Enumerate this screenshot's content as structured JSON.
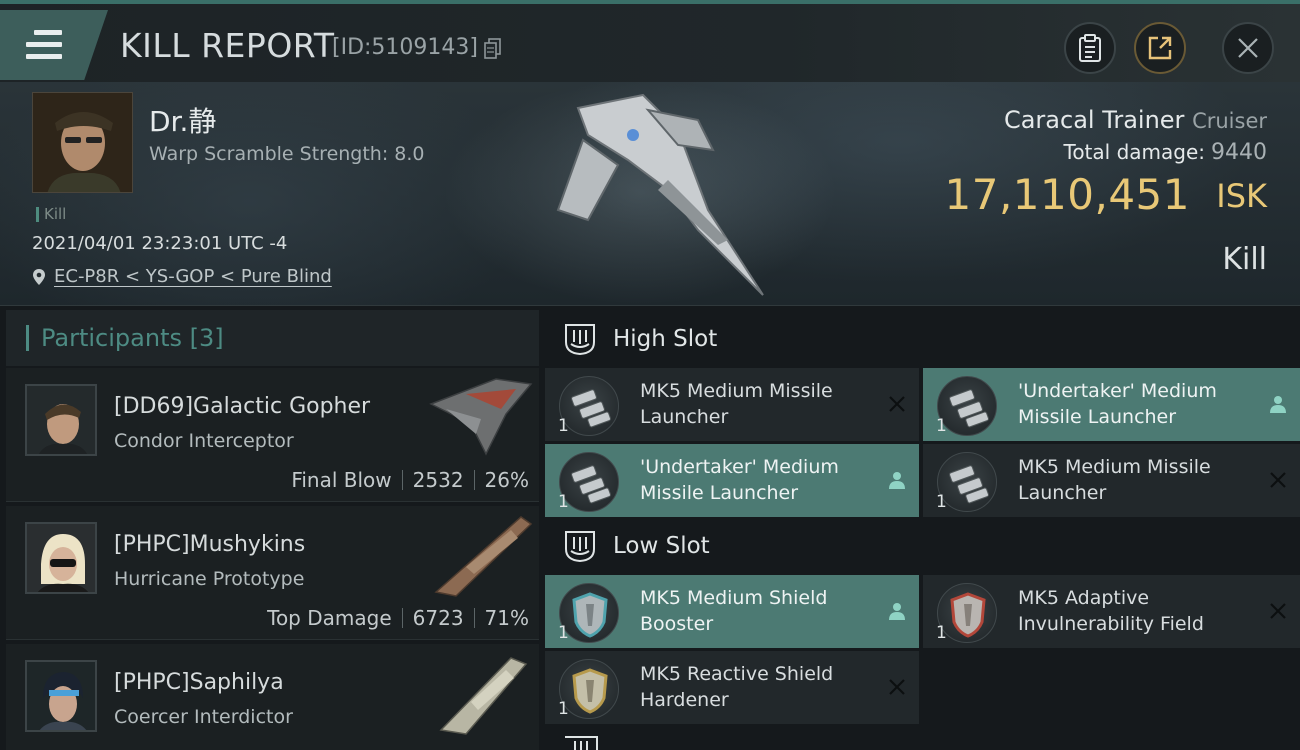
{
  "header": {
    "title": "KILL REPORT",
    "report_id": "[ID:5109143]",
    "icons": {
      "menu": "hamburger-menu-icon",
      "copy": "copy-icon",
      "clipboard": "clipboard-icon",
      "export": "export-icon",
      "close": "close-icon"
    }
  },
  "victim": {
    "name": "Dr.静",
    "warp_scramble": "Warp Scramble Strength: 8.0",
    "tag": "Kill",
    "datetime": "2021/04/01 23:23:01 UTC -4",
    "location": "EC-P8R < YS-GOP < Pure Blind",
    "ship_name": "Caracal Trainer",
    "ship_class": "Cruiser",
    "total_damage_label": "Total damage:",
    "total_damage_value": "9440",
    "isk_value": "17,110,451",
    "isk_unit": "ISK",
    "result": "Kill"
  },
  "participants": {
    "label": "Participants",
    "count": "[3]",
    "items": [
      {
        "name": "[DD69]Galactic Gopher",
        "ship": "Condor Interceptor",
        "role": "Final Blow",
        "damage": "2532",
        "percent": "26%"
      },
      {
        "name": "[PHPC]Mushykins",
        "ship": "Hurricane Prototype",
        "role": "Top Damage",
        "damage": "6723",
        "percent": "71%"
      },
      {
        "name": "[PHPC]Saphilya",
        "ship": "Coercer Interdictor"
      }
    ]
  },
  "slots": {
    "high": {
      "label": "High Slot",
      "modules": [
        {
          "qty": "1",
          "name": "MK5 Medium Missile Launcher",
          "status_icon": "close-icon"
        },
        {
          "qty": "1",
          "name": "'Undertaker' Medium Missile Launcher",
          "status_icon": "person-icon"
        },
        {
          "qty": "1",
          "name": "'Undertaker' Medium Missile Launcher",
          "status_icon": "person-icon"
        },
        {
          "qty": "1",
          "name": "MK5 Medium Missile Launcher",
          "status_icon": "close-icon"
        }
      ]
    },
    "low": {
      "label": "Low Slot",
      "modules": [
        {
          "qty": "1",
          "name": "MK5 Medium Shield Booster",
          "status_icon": "person-icon"
        },
        {
          "qty": "1",
          "name": "MK5 Adaptive Invulnerability Field",
          "status_icon": "close-icon"
        },
        {
          "qty": "1",
          "name": "MK5 Reactive Shield Hardener",
          "status_icon": "close-icon"
        }
      ]
    }
  },
  "colors": {
    "accent_teal": "#4c7a73",
    "isk_gold": "#e8c877",
    "participants_label": "#4d8b83"
  }
}
